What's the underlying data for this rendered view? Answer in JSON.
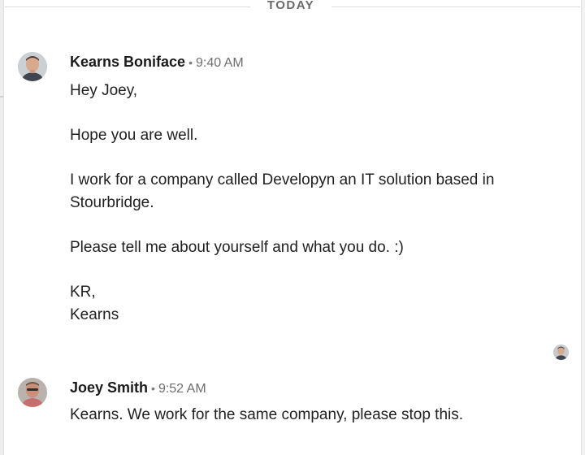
{
  "divider": {
    "label": "TODAY"
  },
  "messages": [
    {
      "sender": "Kearns Boniface",
      "separator": "•",
      "time": "9:40 AM",
      "lines": [
        "Hey Joey,",
        "Hope you are well.",
        "I work for a company called Developyn an IT solution based in",
        "Stourbridge.",
        "Please tell me about yourself and what you do. :)",
        "KR,",
        "Kearns"
      ]
    },
    {
      "sender": "Joey Smith",
      "separator": "•",
      "time": "9:52 AM",
      "lines": [
        "Kearns. We work for the same company, please stop this."
      ]
    }
  ],
  "icons": {
    "avatar_1": "avatar-kearns-icon",
    "avatar_2": "avatar-joey-icon",
    "read_receipt": "read-receipt-avatar-icon"
  }
}
